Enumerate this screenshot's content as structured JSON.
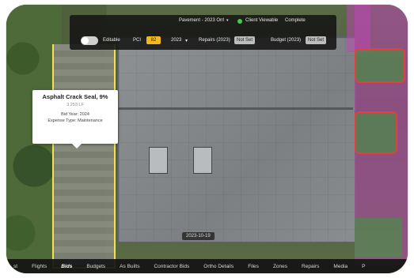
{
  "toolbar": {
    "layer_title": "Pavement - 2023 Orrl",
    "client_viewable_label": "Client Viewable",
    "complete_label": "Complete",
    "editable_label": "Editable",
    "pci_label": "PCI",
    "pci_value": "82",
    "year_value": "2023",
    "repairs_label": "Repairs (2023)",
    "repairs_badge": "Not Set",
    "budget_label": "Budget (2023)",
    "budget_badge": "Not Set",
    "status_dot_color": "#3bd14b"
  },
  "popup": {
    "title": "Asphalt Crack Seal, 9%",
    "subtitle": "3,253 LF",
    "bid_year": "Bid Year: 2024",
    "expense_type": "Expense Type: Maintenance"
  },
  "map": {
    "date_badge": "2023-10-19"
  },
  "bottom_nav": {
    "items": [
      "st",
      "Flights",
      "Bids",
      "Budgets",
      "As Builts",
      "Contractor Bids",
      "Ortho Details",
      "Files",
      "Zones",
      "Repairs",
      "Media",
      "P"
    ],
    "active_index": 2
  },
  "colors": {
    "accent_yellow": "#f2b81f",
    "zone_purple": "#be46b4",
    "zone_line_yellow": "#f5e14a",
    "zone_line_red": "#e2403b"
  }
}
